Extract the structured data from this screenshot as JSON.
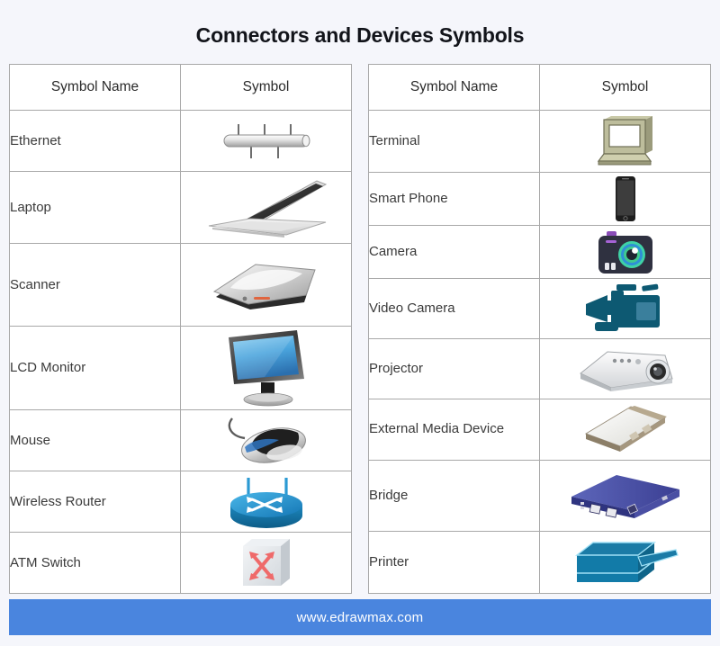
{
  "title": "Connectors and Devices Symbols",
  "footer": {
    "url": "www.edrawmax.com"
  },
  "colors": {
    "background": "#f5f6fb",
    "footer_bar": "#4a85de",
    "table_border": "#a8a8a8",
    "title_text": "#12141a",
    "cell_text": "#3a3a3a"
  },
  "tables": [
    {
      "id": "left-table",
      "headers": {
        "name": "Symbol Name",
        "symbol": "Symbol"
      },
      "rows": [
        {
          "name": "Ethernet",
          "icon": "ethernet-icon"
        },
        {
          "name": "Laptop",
          "icon": "laptop-icon"
        },
        {
          "name": "Scanner",
          "icon": "scanner-icon"
        },
        {
          "name": "LCD Monitor",
          "icon": "lcd-monitor-icon"
        },
        {
          "name": "Mouse",
          "icon": "mouse-icon"
        },
        {
          "name": "Wireless Router",
          "icon": "wireless-router-icon"
        },
        {
          "name": "ATM Switch",
          "icon": "atm-switch-icon"
        }
      ]
    },
    {
      "id": "right-table",
      "headers": {
        "name": "Symbol Name",
        "symbol": "Symbol"
      },
      "rows": [
        {
          "name": "Terminal",
          "icon": "terminal-icon"
        },
        {
          "name": "Smart Phone",
          "icon": "smart-phone-icon"
        },
        {
          "name": "Camera",
          "icon": "camera-icon"
        },
        {
          "name": "Video Camera",
          "icon": "video-camera-icon"
        },
        {
          "name": "Projector",
          "icon": "projector-icon"
        },
        {
          "name": "External Media Device",
          "icon": "external-media-device-icon"
        },
        {
          "name": "Bridge",
          "icon": "bridge-icon"
        },
        {
          "name": "Printer",
          "icon": "printer-icon"
        }
      ]
    }
  ]
}
